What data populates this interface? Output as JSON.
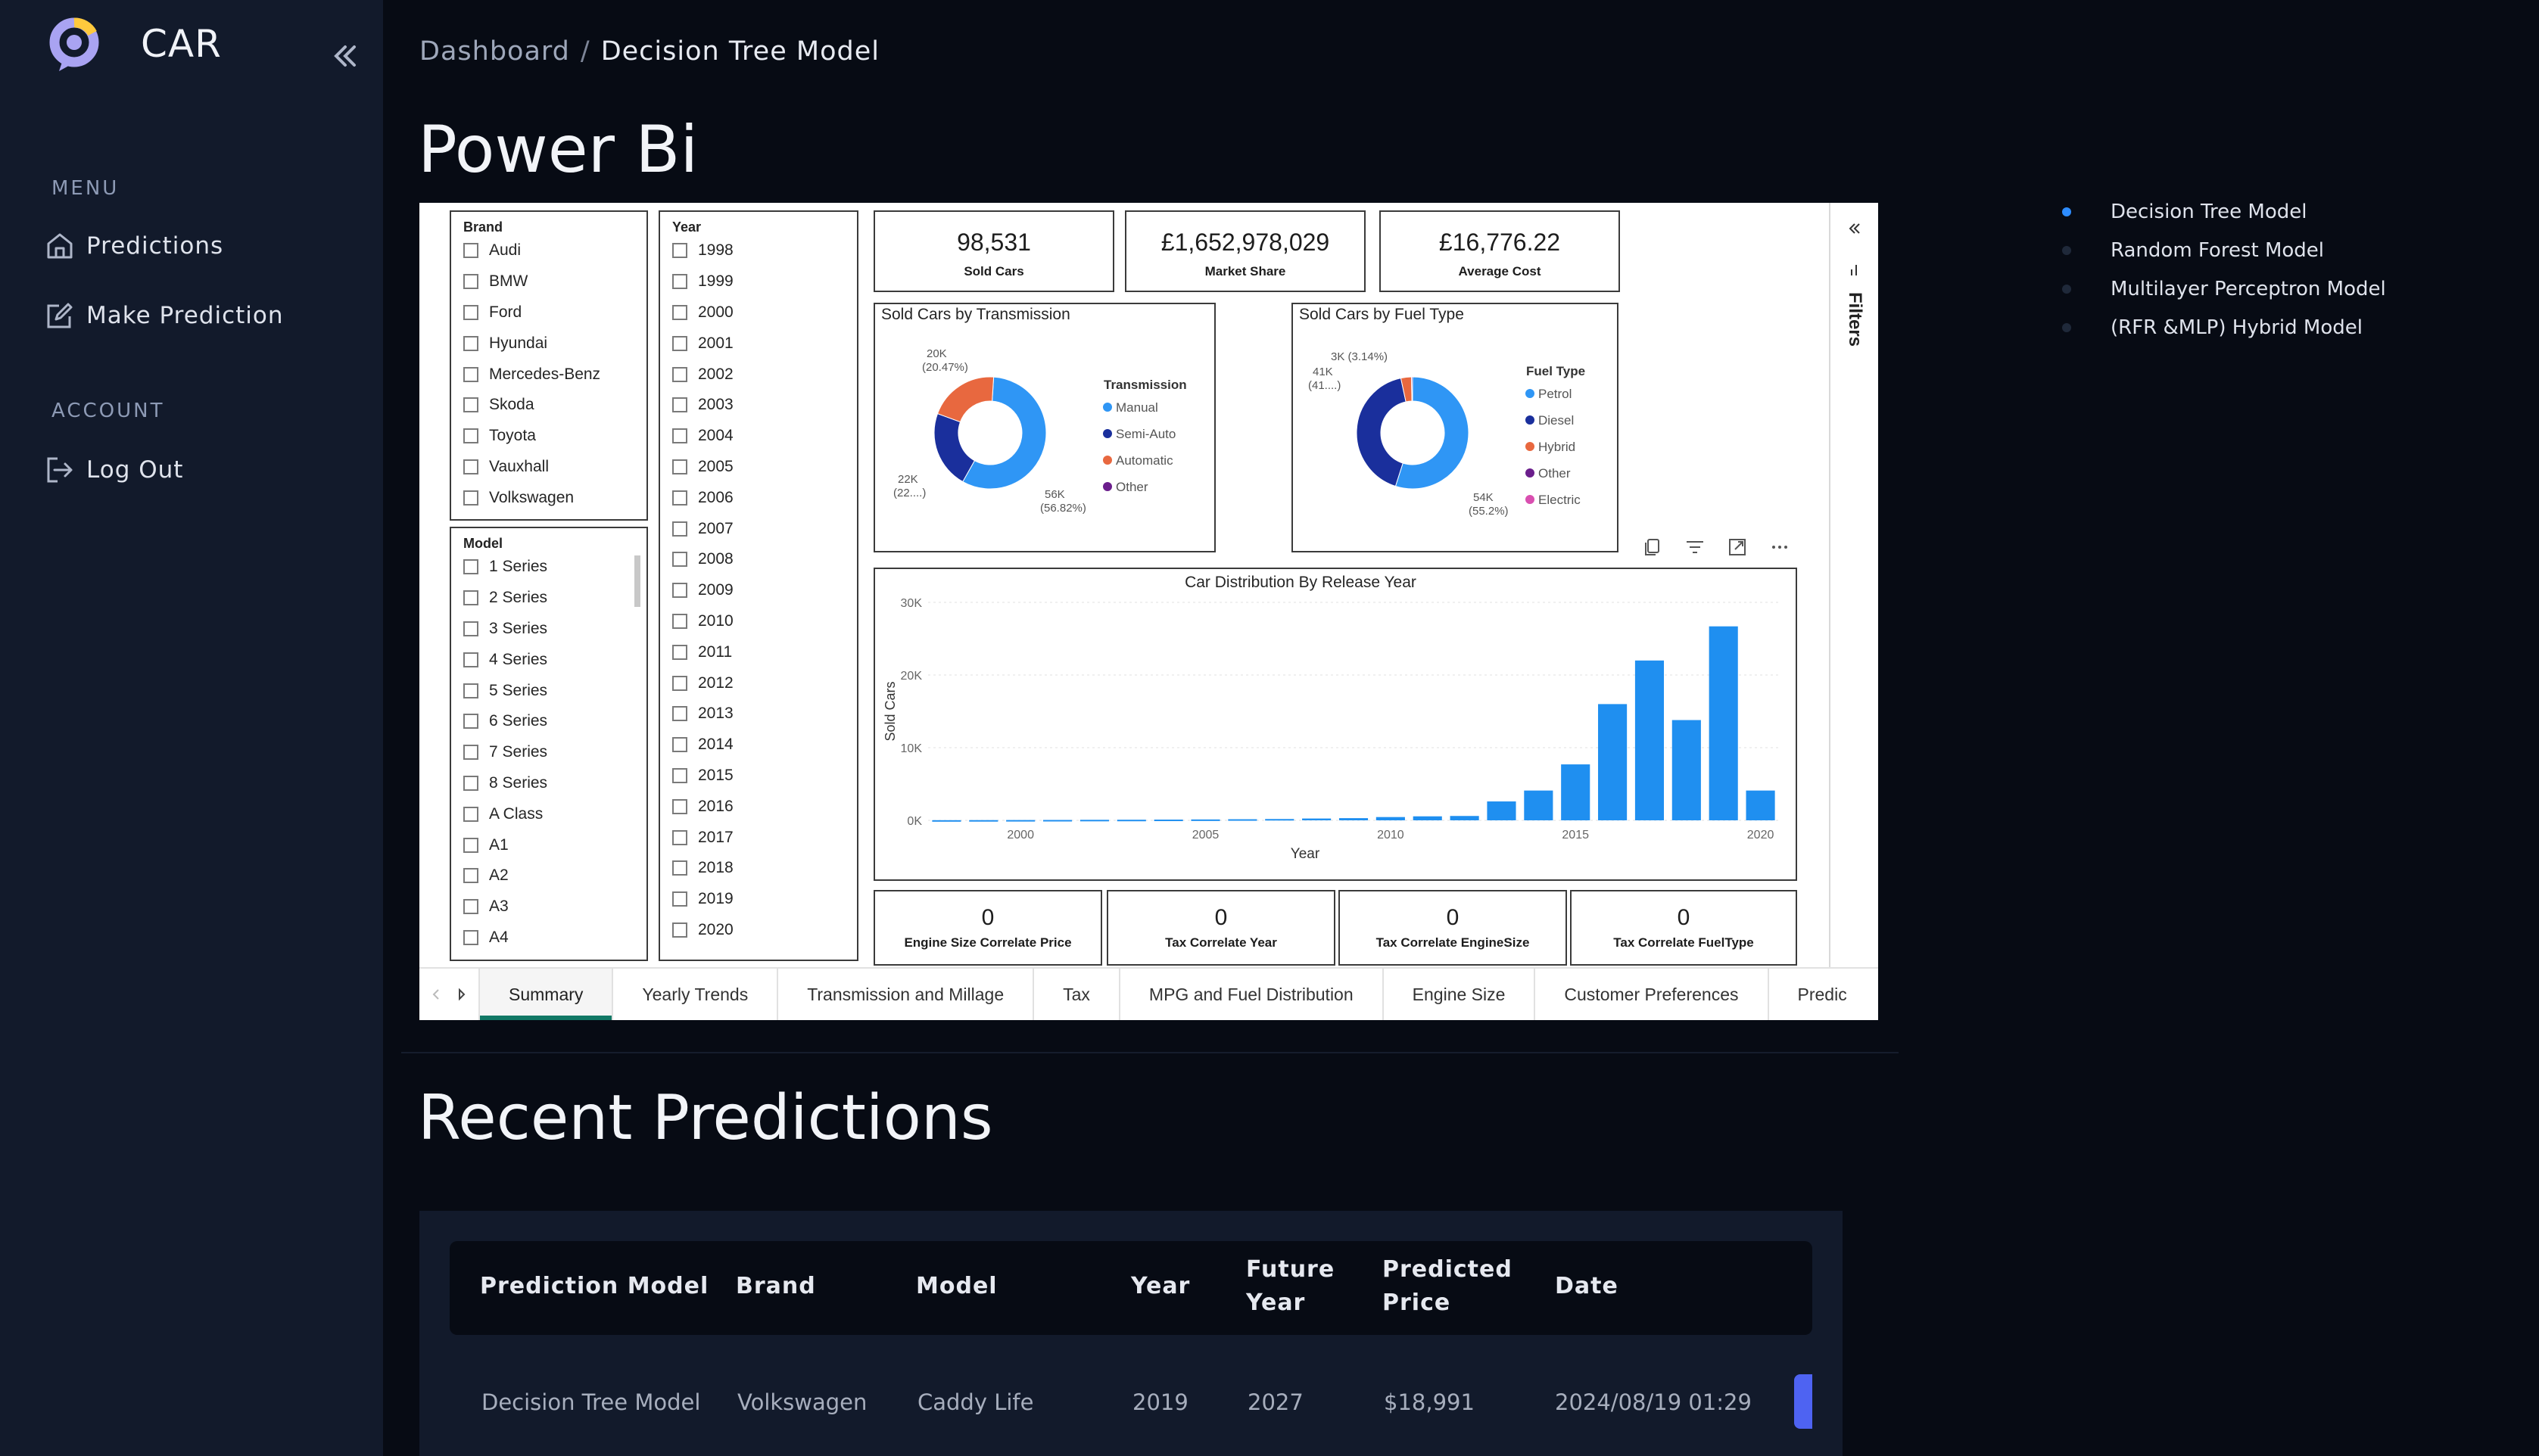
{
  "sidebar": {
    "brand": "CAR",
    "menu_heading": "MENU",
    "menu_items": [
      {
        "label": "Predictions",
        "icon": "home-icon"
      },
      {
        "label": "Make Prediction",
        "icon": "edit-icon"
      }
    ],
    "account_heading": "ACCOUNT",
    "account_items": [
      {
        "label": "Log Out",
        "icon": "logout-icon"
      }
    ]
  },
  "breadcrumb": {
    "root": "Dashboard",
    "current": "Decision Tree Model"
  },
  "page_title": "Power Bi",
  "powerbi": {
    "brand_slicer": {
      "title": "Brand",
      "items": [
        "Audi",
        "BMW",
        "Ford",
        "Hyundai",
        "Mercedes-Benz",
        "Skoda",
        "Toyota",
        "Vauxhall",
        "Volkswagen"
      ]
    },
    "model_slicer": {
      "title": "Model",
      "items": [
        "1 Series",
        "2 Series",
        "3 Series",
        "4 Series",
        "5 Series",
        "6 Series",
        "7 Series",
        "8 Series",
        "A Class",
        "A1",
        "A2",
        "A3",
        "A4"
      ]
    },
    "year_slicer": {
      "title": "Year",
      "items": [
        "1998",
        "1999",
        "2000",
        "2001",
        "2002",
        "2003",
        "2004",
        "2005",
        "2006",
        "2007",
        "2008",
        "2009",
        "2010",
        "2011",
        "2012",
        "2013",
        "2014",
        "2015",
        "2016",
        "2017",
        "2018",
        "2019",
        "2020"
      ]
    },
    "kpi_cards": [
      {
        "value": "98,531",
        "label": "Sold Cars"
      },
      {
        "value": "£1,652,978,029",
        "label": "Market Share"
      },
      {
        "value": "£16,776.22",
        "label": "Average Cost"
      }
    ],
    "bottom_cards": [
      {
        "value": "0",
        "label": "Engine Size Correlate Price"
      },
      {
        "value": "0",
        "label": "Tax Correlate Year"
      },
      {
        "value": "0",
        "label": "Tax Correlate EngineSize"
      },
      {
        "value": "0",
        "label": "Tax Correlate FuelType"
      }
    ],
    "filters_label": "Filters",
    "tabs": [
      "Summary",
      "Yearly Trends",
      "Transmission and Millage",
      "Tax",
      "MPG and Fuel Distribution",
      "Engine Size",
      "Customer Preferences",
      "Predic"
    ],
    "active_tab": "Summary"
  },
  "chart_data": [
    {
      "type": "pie",
      "title": "Sold Cars by Transmission",
      "legend_title": "Transmission",
      "categories": [
        "Manual",
        "Semi-Auto",
        "Automatic",
        "Other"
      ],
      "values": [
        56,
        22,
        20,
        0.01
      ],
      "colors": [
        "#2f96f5",
        "#1a2f9c",
        "#e8683f",
        "#6b1e8c"
      ],
      "labels": [
        {
          "line1": "56K",
          "line2": "(56.82%)"
        },
        {
          "line1": "22K",
          "line2": "(22....)"
        },
        {
          "line1": "20K",
          "line2": "(20.47%)"
        }
      ]
    },
    {
      "type": "pie",
      "title": "Sold Cars by Fuel Type",
      "legend_title": "Fuel Type",
      "categories": [
        "Petrol",
        "Diesel",
        "Hybrid",
        "Other",
        "Electric"
      ],
      "values": [
        54,
        41,
        3,
        0.3,
        0.01
      ],
      "colors": [
        "#2f96f5",
        "#1a2f9c",
        "#e8683f",
        "#6b1e8c",
        "#d94fb0"
      ],
      "labels": [
        {
          "line1": "54K",
          "line2": "(55.2%)"
        },
        {
          "line1": "41K",
          "line2": "(41....)"
        },
        {
          "line1": "3K (3.14%)",
          "line2": ""
        }
      ]
    },
    {
      "type": "bar",
      "title": "Car Distribution By Release Year",
      "xlabel": "Year",
      "ylabel": "Sold Cars",
      "x": [
        1998,
        1999,
        2000,
        2001,
        2002,
        2003,
        2004,
        2005,
        2006,
        2007,
        2008,
        2009,
        2010,
        2011,
        2012,
        2013,
        2014,
        2015,
        2016,
        2017,
        2018,
        2019,
        2020
      ],
      "values": [
        20,
        30,
        40,
        50,
        70,
        80,
        100,
        120,
        150,
        180,
        250,
        300,
        450,
        550,
        600,
        2600,
        4100,
        7700,
        16000,
        22000,
        13800,
        26700,
        4100
      ],
      "ylim": [
        0,
        30000
      ],
      "yticks": [
        "0K",
        "10K",
        "20K",
        "30K"
      ],
      "xticks": [
        "2000",
        "2005",
        "2010",
        "2015",
        "2020"
      ],
      "color": "#1f8ff0"
    }
  ],
  "right_nav": {
    "items": [
      "Decision Tree Model",
      "Random Forest Model",
      "Multilayer Perceptron Model",
      "(RFR &MLP) Hybrid Model"
    ],
    "active_index": 0
  },
  "recent": {
    "title": "Recent Predictions",
    "headers": [
      {
        "l1": "Prediction Model",
        "l2": ""
      },
      {
        "l1": "Brand",
        "l2": ""
      },
      {
        "l1": "Model",
        "l2": ""
      },
      {
        "l1": "Year",
        "l2": ""
      },
      {
        "l1": "Future",
        "l2": "Year"
      },
      {
        "l1": "Predicted",
        "l2": "Price"
      },
      {
        "l1": "Date",
        "l2": ""
      }
    ],
    "rows": [
      {
        "model": "Decision Tree Model",
        "brand": "Volkswagen",
        "car_model": "Caddy Life",
        "year": "2019",
        "future_year": "2027",
        "price": "$18,991",
        "date": "2024/08/19 01:29"
      }
    ]
  }
}
